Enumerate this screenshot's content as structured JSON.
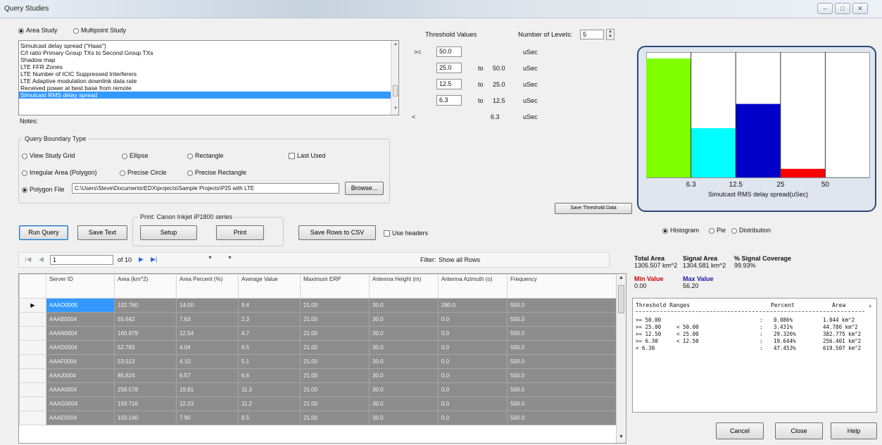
{
  "window": {
    "title": "Query Studies"
  },
  "study_type": {
    "area_label": "Area Study",
    "multipoint_label": "Multipoint Study",
    "selected": "area"
  },
  "studies": [
    "Simulcast delay spread (\"Haas\")",
    "C/I ratio Primary Group TXs to Second Group TXs",
    "Shadow map",
    "LTE FFR Zones",
    "LTE Number of ICIC Suppressed Interferers",
    "LTE Adaptive modulation downlink data rate",
    "Received power at best base from remote",
    "Simulcast RMS delay spread"
  ],
  "selected_study_index": 7,
  "notes_label": "Notes:",
  "threshold": {
    "header": "Threshold Values",
    "levels_label": "Number of Levels:",
    "levels_value": "5",
    "rows": [
      {
        "op": ">=",
        "low": "50.0",
        "to": "",
        "high": "",
        "unit": "uSec"
      },
      {
        "op": "",
        "low": "25.0",
        "to": "to",
        "high": "50.0",
        "unit": "uSec"
      },
      {
        "op": "",
        "low": "12.5",
        "to": "to",
        "high": "25.0",
        "unit": "uSec"
      },
      {
        "op": "",
        "low": "6.3",
        "to": "to",
        "high": "12.5",
        "unit": "uSec"
      },
      {
        "op": "<",
        "low": "",
        "to": "",
        "high": "6.3",
        "unit": "uSec"
      }
    ]
  },
  "boundary": {
    "legend": "Query Boundary Type",
    "view_grid": "View Study Grid",
    "ellipse": "Ellipse",
    "rectangle": "Rectangle",
    "last_used": "Last Used",
    "irregular": "Irregular Area (Polygon)",
    "precise_circle": "Precise Circle",
    "precise_rectangle": "Precise Rectangle",
    "polygon_file": "Polygon File",
    "polygon_path": "C:\\Users\\Steve\\Documents\\EDX\\projects\\Sample Projects\\P25 with LTE",
    "browse": "Browse..."
  },
  "save_threshold": "Save Threshold Data",
  "print_group": {
    "legend": "Print: Canon Inkjet iP1800 series",
    "setup": "Setup",
    "print": "Print"
  },
  "actions": {
    "run_query": "Run Query",
    "save_text": "Save Text",
    "save_csv": "Save Rows to CSV",
    "use_headers": "Use headers"
  },
  "pager": {
    "first": "|◀",
    "prev": "◀",
    "page": "1",
    "of": "of 10",
    "next": "▶",
    "last": "▶|",
    "filter_label": "Filter:",
    "filter_value": "Show all Rows"
  },
  "table": {
    "columns": [
      "Server ID",
      "Area (km^2)",
      "Area Percent (%)",
      "Average Value",
      "Maximum ERP",
      "Antenna Height (m)",
      "Antenna Azimuth (o)",
      "Frequency"
    ],
    "rows": [
      [
        "AAAO0005",
        "102.760",
        "14.00",
        "9.4",
        "21.00",
        "30.0",
        "280.0",
        "500.0"
      ],
      [
        "AAAB0004",
        "55.642",
        "7.63",
        "2.3",
        "21.00",
        "30.0",
        "0.0",
        "500.0"
      ],
      [
        "AAAN0004",
        "160.879",
        "12.54",
        "4.7",
        "21.00",
        "30.0",
        "0.0",
        "500.0"
      ],
      [
        "AAAD0004",
        "52.783",
        "4.04",
        "6.5",
        "21.00",
        "30.0",
        "0.0",
        "500.0"
      ],
      [
        "AAAF0004",
        "53.513",
        "4.10",
        "5.1",
        "21.00",
        "30.0",
        "0.0",
        "500.0"
      ],
      [
        "AAAJ0004",
        "85.824",
        "6.57",
        "6.6",
        "21.00",
        "30.0",
        "0.0",
        "500.0"
      ],
      [
        "AAAA0004",
        "258.578",
        "19.81",
        "11.3",
        "21.00",
        "30.0",
        "0.0",
        "500.0"
      ],
      [
        "AAAG0004",
        "159.716",
        "12.23",
        "11.2",
        "21.00",
        "30.0",
        "0.0",
        "500.0"
      ],
      [
        "AAAE0004",
        "103.140",
        "7.90",
        "8.5",
        "21.00",
        "30.0",
        "0.0",
        "500.0"
      ]
    ]
  },
  "chart_data": {
    "type": "bar",
    "categories": [
      "< 6.3",
      "6.3 - 12.5",
      "12.5 - 25",
      "25 - 50",
      ">= 50"
    ],
    "values": [
      47.453,
      19.644,
      29.326,
      3.431,
      0.086
    ],
    "colors": [
      "#7fff00",
      "#00ffff",
      "#0000c8",
      "#ff0000",
      "#ffffff"
    ],
    "tick_labels": [
      "6.3",
      "12.5",
      "25",
      "50"
    ],
    "xlabel": "Simulcast RMS delay spread(uSec)",
    "ylim": [
      0,
      50
    ]
  },
  "chart_type": {
    "histogram": "Histogram",
    "pie": "Pie",
    "distribution": "Distribution",
    "selected": "histogram"
  },
  "stats": {
    "total_area_label": "Total Area",
    "total_area": "1305.507 km^2",
    "signal_area_label": "Signal Area",
    "signal_area": "1304.581 km^2",
    "coverage_label": "% Signal Coverage",
    "coverage": "99.93%",
    "min_label": "Min Value",
    "min_value": "0.00",
    "max_label": "Max Value",
    "max_value": "56.20",
    "min_color": "#d40000",
    "max_color": "#1a1aa6"
  },
  "threshold_table": {
    "header": [
      "Threshold Ranges",
      "Percent",
      "Area"
    ],
    "rows": [
      [
        ">= 50.00",
        "",
        "0.086%",
        "1.044 km^2"
      ],
      [
        ">= 25.00",
        "< 50.00",
        "3.431%",
        "44.786 km^2"
      ],
      [
        ">= 12.50",
        "< 25.00",
        "29.326%",
        "382.775 km^2"
      ],
      [
        ">= 6.30",
        "< 12.50",
        "19.644%",
        "256.401 km^2"
      ],
      [
        "< 6.30",
        "",
        "47.453%",
        "619.507 km^2"
      ]
    ]
  },
  "dialog_buttons": {
    "cancel": "Cancel",
    "close": "Close",
    "help": "Help"
  }
}
